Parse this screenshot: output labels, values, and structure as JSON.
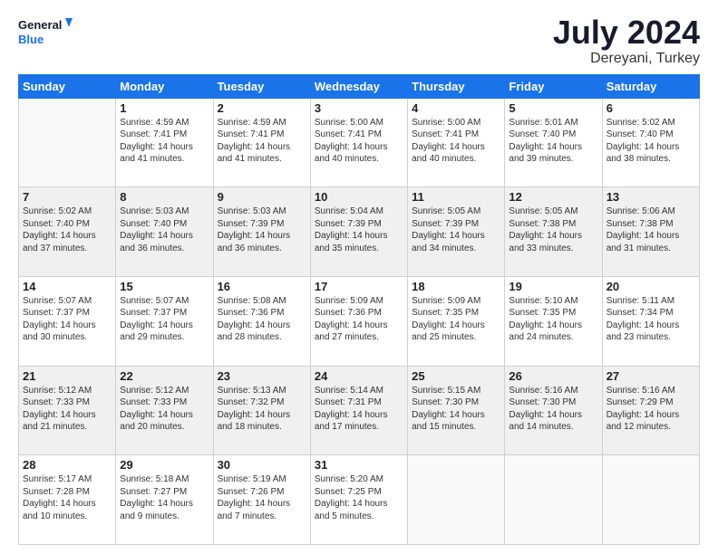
{
  "logo": {
    "line1": "General",
    "line2": "Blue"
  },
  "title": "July 2024",
  "subtitle": "Dereyani, Turkey",
  "weekdays": [
    "Sunday",
    "Monday",
    "Tuesday",
    "Wednesday",
    "Thursday",
    "Friday",
    "Saturday"
  ],
  "weeks": [
    [
      {
        "day": "",
        "empty": true
      },
      {
        "day": "1",
        "sunrise": "4:59 AM",
        "sunset": "7:41 PM",
        "daylight": "14 hours and 41 minutes."
      },
      {
        "day": "2",
        "sunrise": "4:59 AM",
        "sunset": "7:41 PM",
        "daylight": "14 hours and 41 minutes."
      },
      {
        "day": "3",
        "sunrise": "5:00 AM",
        "sunset": "7:41 PM",
        "daylight": "14 hours and 40 minutes."
      },
      {
        "day": "4",
        "sunrise": "5:00 AM",
        "sunset": "7:41 PM",
        "daylight": "14 hours and 40 minutes."
      },
      {
        "day": "5",
        "sunrise": "5:01 AM",
        "sunset": "7:40 PM",
        "daylight": "14 hours and 39 minutes."
      },
      {
        "day": "6",
        "sunrise": "5:02 AM",
        "sunset": "7:40 PM",
        "daylight": "14 hours and 38 minutes."
      }
    ],
    [
      {
        "day": "7",
        "sunrise": "5:02 AM",
        "sunset": "7:40 PM",
        "daylight": "14 hours and 37 minutes."
      },
      {
        "day": "8",
        "sunrise": "5:03 AM",
        "sunset": "7:40 PM",
        "daylight": "14 hours and 36 minutes."
      },
      {
        "day": "9",
        "sunrise": "5:03 AM",
        "sunset": "7:39 PM",
        "daylight": "14 hours and 36 minutes."
      },
      {
        "day": "10",
        "sunrise": "5:04 AM",
        "sunset": "7:39 PM",
        "daylight": "14 hours and 35 minutes."
      },
      {
        "day": "11",
        "sunrise": "5:05 AM",
        "sunset": "7:39 PM",
        "daylight": "14 hours and 34 minutes."
      },
      {
        "day": "12",
        "sunrise": "5:05 AM",
        "sunset": "7:38 PM",
        "daylight": "14 hours and 33 minutes."
      },
      {
        "day": "13",
        "sunrise": "5:06 AM",
        "sunset": "7:38 PM",
        "daylight": "14 hours and 31 minutes."
      }
    ],
    [
      {
        "day": "14",
        "sunrise": "5:07 AM",
        "sunset": "7:37 PM",
        "daylight": "14 hours and 30 minutes."
      },
      {
        "day": "15",
        "sunrise": "5:07 AM",
        "sunset": "7:37 PM",
        "daylight": "14 hours and 29 minutes."
      },
      {
        "day": "16",
        "sunrise": "5:08 AM",
        "sunset": "7:36 PM",
        "daylight": "14 hours and 28 minutes."
      },
      {
        "day": "17",
        "sunrise": "5:09 AM",
        "sunset": "7:36 PM",
        "daylight": "14 hours and 27 minutes."
      },
      {
        "day": "18",
        "sunrise": "5:09 AM",
        "sunset": "7:35 PM",
        "daylight": "14 hours and 25 minutes."
      },
      {
        "day": "19",
        "sunrise": "5:10 AM",
        "sunset": "7:35 PM",
        "daylight": "14 hours and 24 minutes."
      },
      {
        "day": "20",
        "sunrise": "5:11 AM",
        "sunset": "7:34 PM",
        "daylight": "14 hours and 23 minutes."
      }
    ],
    [
      {
        "day": "21",
        "sunrise": "5:12 AM",
        "sunset": "7:33 PM",
        "daylight": "14 hours and 21 minutes."
      },
      {
        "day": "22",
        "sunrise": "5:12 AM",
        "sunset": "7:33 PM",
        "daylight": "14 hours and 20 minutes."
      },
      {
        "day": "23",
        "sunrise": "5:13 AM",
        "sunset": "7:32 PM",
        "daylight": "14 hours and 18 minutes."
      },
      {
        "day": "24",
        "sunrise": "5:14 AM",
        "sunset": "7:31 PM",
        "daylight": "14 hours and 17 minutes."
      },
      {
        "day": "25",
        "sunrise": "5:15 AM",
        "sunset": "7:30 PM",
        "daylight": "14 hours and 15 minutes."
      },
      {
        "day": "26",
        "sunrise": "5:16 AM",
        "sunset": "7:30 PM",
        "daylight": "14 hours and 14 minutes."
      },
      {
        "day": "27",
        "sunrise": "5:16 AM",
        "sunset": "7:29 PM",
        "daylight": "14 hours and 12 minutes."
      }
    ],
    [
      {
        "day": "28",
        "sunrise": "5:17 AM",
        "sunset": "7:28 PM",
        "daylight": "14 hours and 10 minutes."
      },
      {
        "day": "29",
        "sunrise": "5:18 AM",
        "sunset": "7:27 PM",
        "daylight": "14 hours and 9 minutes."
      },
      {
        "day": "30",
        "sunrise": "5:19 AM",
        "sunset": "7:26 PM",
        "daylight": "14 hours and 7 minutes."
      },
      {
        "day": "31",
        "sunrise": "5:20 AM",
        "sunset": "7:25 PM",
        "daylight": "14 hours and 5 minutes."
      },
      {
        "day": "",
        "empty": true
      },
      {
        "day": "",
        "empty": true
      },
      {
        "day": "",
        "empty": true
      }
    ]
  ]
}
